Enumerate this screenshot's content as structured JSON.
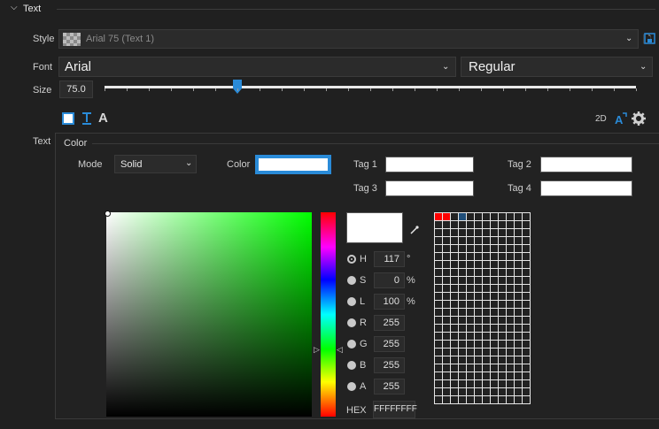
{
  "section": {
    "title": "Text"
  },
  "style": {
    "label": "Style",
    "value": "Arial 75 (Text 1)"
  },
  "font": {
    "label": "Font",
    "family": "Arial",
    "weight": "Regular"
  },
  "size": {
    "label": "Size",
    "value": "75.0",
    "slider_fraction": 0.25
  },
  "text_label": "Text",
  "toolbar": {
    "twod": "2D"
  },
  "color": {
    "title": "Color",
    "mode_label": "Mode",
    "mode_value": "Solid",
    "color_label": "Color",
    "tag1": "Tag 1",
    "tag2": "Tag 2",
    "tag3": "Tag 3",
    "tag4": "Tag 4",
    "current_color": "#FFFFFF",
    "channels": [
      {
        "name": "H",
        "value": "117",
        "unit": "°",
        "selected": true
      },
      {
        "name": "S",
        "value": "0",
        "unit": "%",
        "selected": false
      },
      {
        "name": "L",
        "value": "100",
        "unit": "%",
        "selected": false
      },
      {
        "name": "R",
        "value": "255",
        "unit": "",
        "selected": false
      },
      {
        "name": "G",
        "value": "255",
        "unit": "",
        "selected": false
      },
      {
        "name": "B",
        "value": "255",
        "unit": "",
        "selected": false
      },
      {
        "name": "A",
        "value": "255",
        "unit": "",
        "selected": false
      }
    ],
    "hex_label": "HEX",
    "hex_value": "FFFFFFFF",
    "swatches": [
      "#ff0000",
      "#ff0000",
      "",
      "#1f4e7a"
    ]
  },
  "colors": {
    "accent": "#0078d7",
    "background": "#202020"
  }
}
